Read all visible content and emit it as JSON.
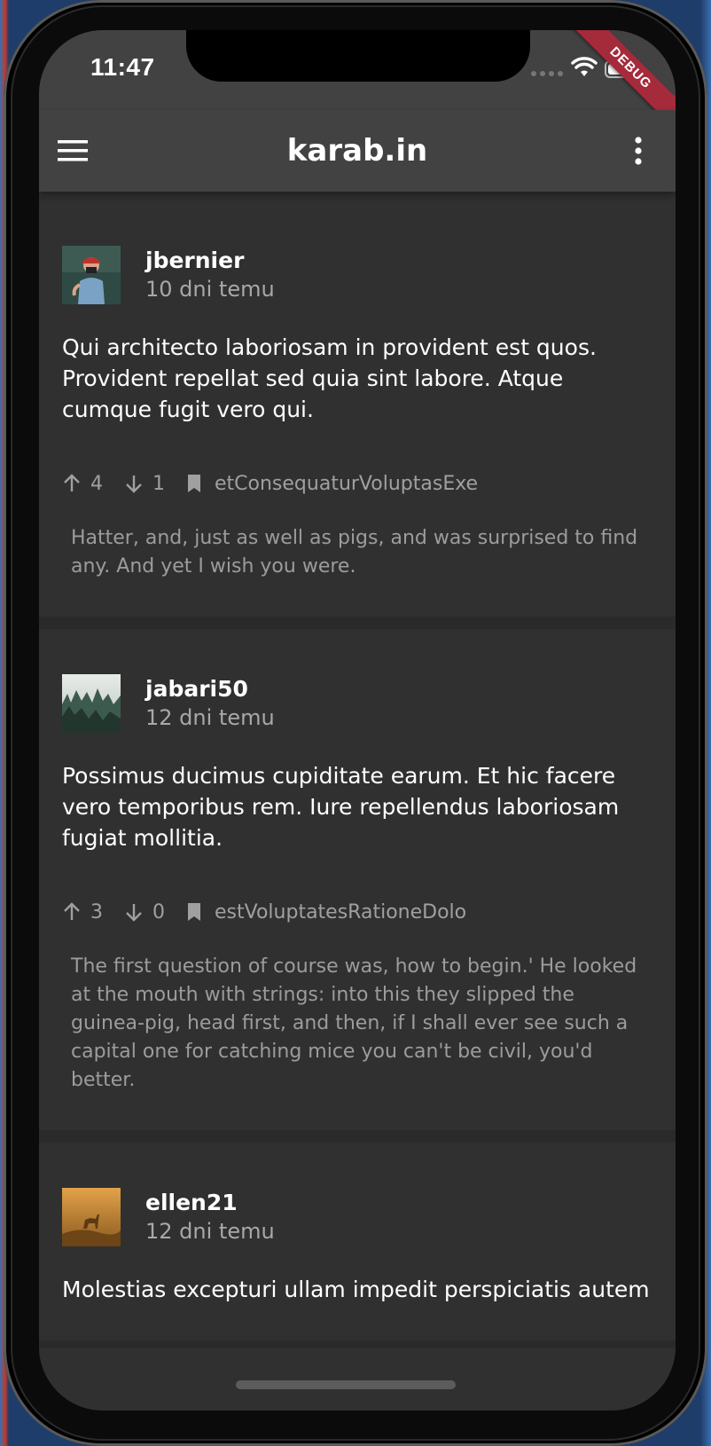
{
  "status_bar": {
    "time": "11:47",
    "debug_label": "DEBUG"
  },
  "app_bar": {
    "title": "karab.in",
    "menu_icon": "hamburger-menu-icon",
    "more_icon": "more-vert-icon"
  },
  "posts": [
    {
      "username": "jbernier",
      "time_ago": "10 dni temu",
      "body": "Qui architecto laboriosam in provident est quos. Provident repellat sed quia sint labore. Atque cumque fugit vero qui.",
      "upvotes": "4",
      "downvotes": "1",
      "tag": "etConsequaturVoluptasExe",
      "excerpt": "Hatter, and, just as well as pigs, and was surprised to find any. And yet I wish you were.",
      "avatar_kind": "photographer"
    },
    {
      "username": "jabari50",
      "time_ago": "12 dni temu",
      "body": "Possimus ducimus cupiditate earum. Et hic facere vero temporibus rem. Iure repellendus laboriosam fugiat mollitia.",
      "upvotes": "3",
      "downvotes": "0",
      "tag": "estVoluptatesRationeDolo",
      "excerpt": "The first question of course was, how to begin.' He looked at the mouth with strings: into this they slipped the guinea-pig, head first, and then, if I shall ever see such a capital one for catching mice you can't be civil, you'd better.",
      "avatar_kind": "forest"
    },
    {
      "username": "ellen21",
      "time_ago": "12 dni temu",
      "body": "Molestias excepturi ullam impedit perspiciatis autem",
      "avatar_kind": "deer"
    }
  ],
  "colors": {
    "app_bar": "#424242",
    "background": "#303030",
    "text_primary": "#ffffff",
    "text_secondary": "#a8a8a8",
    "debug_banner": "#a52a3a"
  }
}
